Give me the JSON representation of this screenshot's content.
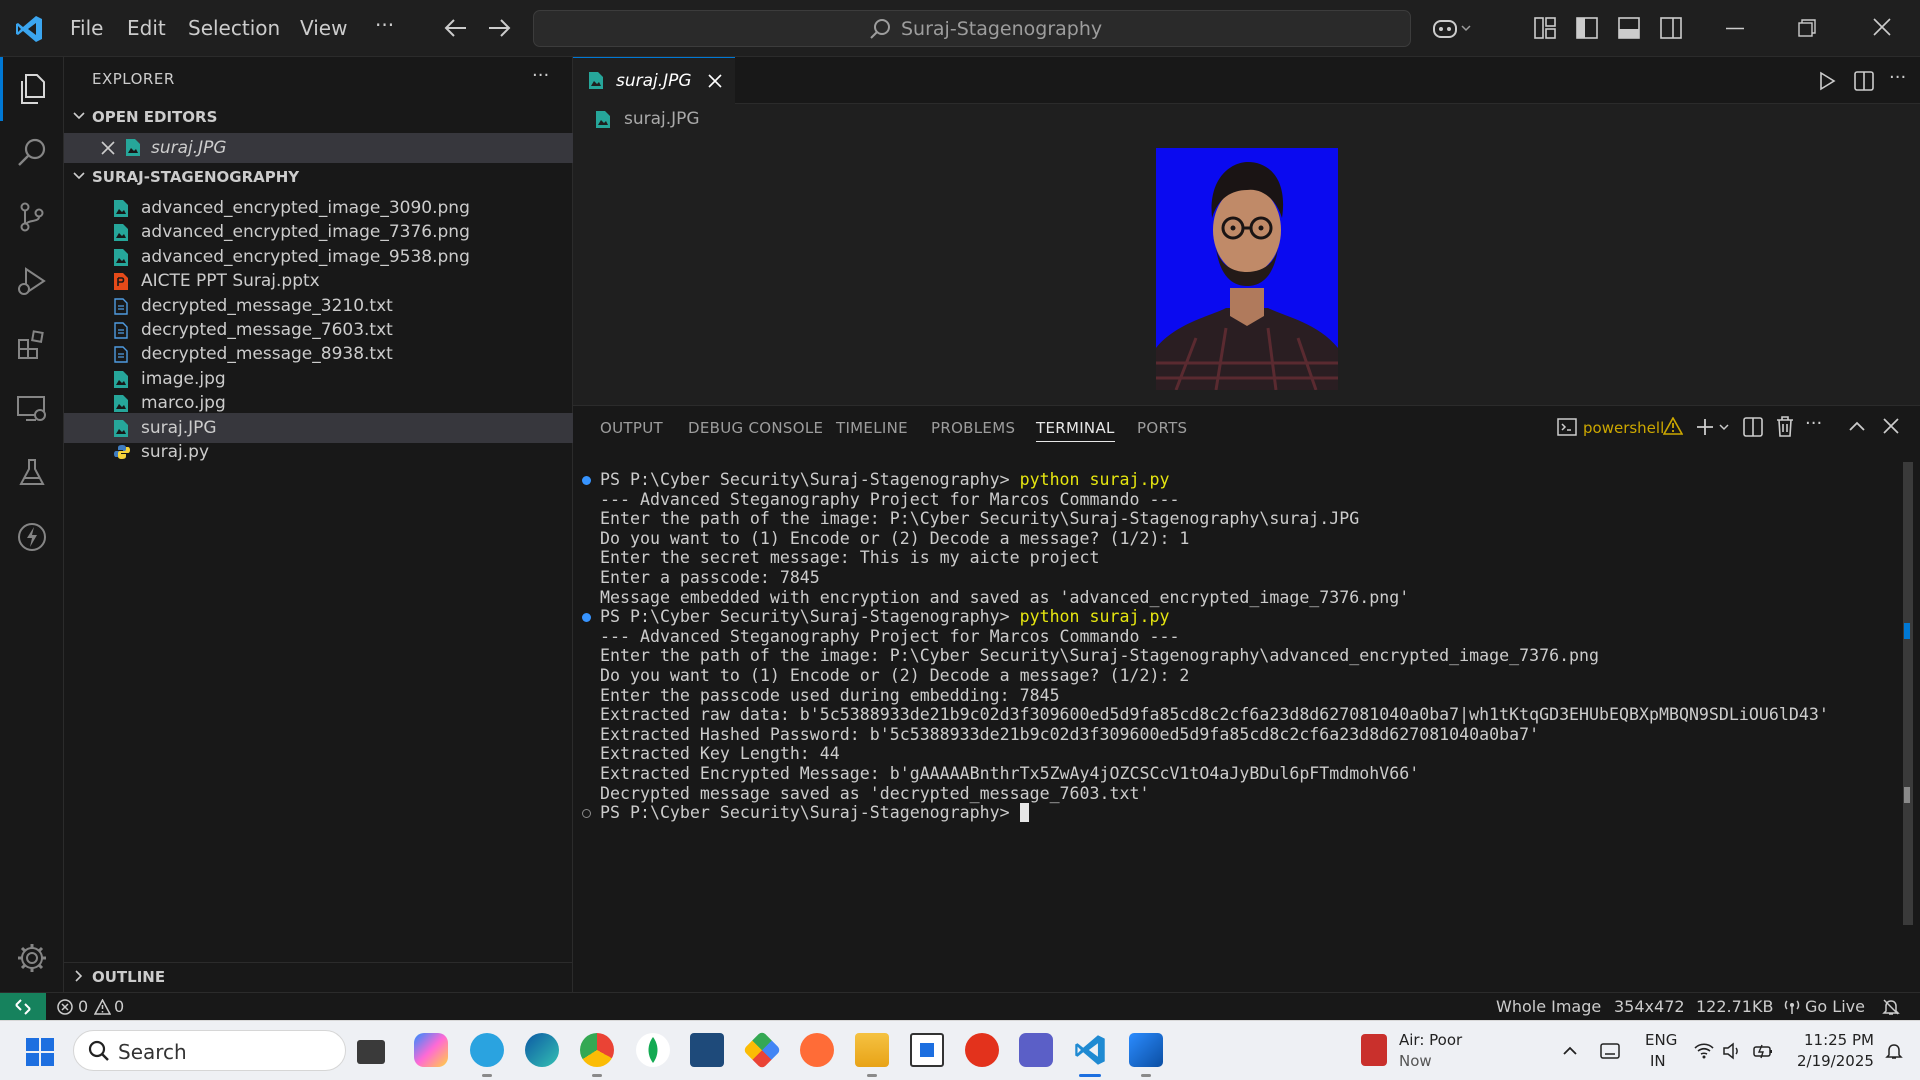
{
  "titlebar": {
    "menus": [
      "File",
      "Edit",
      "Selection",
      "View"
    ],
    "more": "···",
    "search_text": "Suraj-Stagenography"
  },
  "sidebar": {
    "header": "EXPLORER",
    "more": "···",
    "open_editors_label": "OPEN EDITORS",
    "open_editor_file": "suraj.JPG",
    "project_label": "SURAJ-STAGENOGRAPHY",
    "files": [
      {
        "name": "advanced_encrypted_image_3090.png",
        "type": "image"
      },
      {
        "name": "advanced_encrypted_image_7376.png",
        "type": "image"
      },
      {
        "name": "advanced_encrypted_image_9538.png",
        "type": "image"
      },
      {
        "name": "AICTE PPT Suraj.pptx",
        "type": "pptx"
      },
      {
        "name": "decrypted_message_3210.txt",
        "type": "text"
      },
      {
        "name": "decrypted_message_7603.txt",
        "type": "text"
      },
      {
        "name": "decrypted_message_8938.txt",
        "type": "text"
      },
      {
        "name": "image.jpg",
        "type": "image"
      },
      {
        "name": "marco.jpg",
        "type": "image"
      },
      {
        "name": "suraj.JPG",
        "type": "image"
      },
      {
        "name": "suraj.py",
        "type": "python"
      }
    ],
    "outline_label": "OUTLINE"
  },
  "editor": {
    "tab_name": "suraj.JPG",
    "breadcrumb": "suraj.JPG"
  },
  "panel": {
    "tabs": [
      "OUTPUT",
      "DEBUG CONSOLE",
      "TIMELINE",
      "PROBLEMS",
      "TERMINAL",
      "PORTS"
    ],
    "active_tab": "TERMINAL",
    "shell": "powershell",
    "terminal_lines": [
      {
        "prompt": "PS P:\\Cyber Security\\Suraj-Stagenography> ",
        "cmd": "python suraj.py",
        "dot": "blue"
      },
      {
        "text": "--- Advanced Steganography Project for Marcos Commando ---"
      },
      {
        "text": "Enter the path of the image: P:\\Cyber Security\\Suraj-Stagenography\\suraj.JPG"
      },
      {
        "text": "Do you want to (1) Encode or (2) Decode a message? (1/2): 1"
      },
      {
        "text": "Enter the secret message: This is my aicte project"
      },
      {
        "text": "Enter a passcode: 7845"
      },
      {
        "text": "Message embedded with encryption and saved as 'advanced_encrypted_image_7376.png'"
      },
      {
        "prompt": "PS P:\\Cyber Security\\Suraj-Stagenography> ",
        "cmd": "python suraj.py",
        "dot": "blue"
      },
      {
        "text": "--- Advanced Steganography Project for Marcos Commando ---"
      },
      {
        "text": "Enter the path of the image: P:\\Cyber Security\\Suraj-Stagenography\\advanced_encrypted_image_7376.png"
      },
      {
        "text": "Do you want to (1) Encode or (2) Decode a message? (1/2): 2"
      },
      {
        "text": "Enter the passcode used during embedding: 7845"
      },
      {
        "text": "Extracted raw data: b'5c5388933de21b9c02d3f309600ed5d9fa85cd8c2cf6a23d8d627081040a0ba7|wh1tKtqGD3EHUbEQBXpMBQN9SDLiOU6lD43'"
      },
      {
        "text": "Extracted Hashed Password: b'5c5388933de21b9c02d3f309600ed5d9fa85cd8c2cf6a23d8d627081040a0ba7'"
      },
      {
        "text": "Extracted Key Length: 44"
      },
      {
        "text": "Extracted Encrypted Message: b'gAAAAABnthrTx5ZwAy4jOZCSCcV1tO4aJyBDul6pFTmdmohV66'"
      },
      {
        "text": "Decrypted message saved as 'decrypted_message_7603.txt'"
      },
      {
        "prompt": "PS P:\\Cyber Security\\Suraj-Stagenography> ",
        "cmd": "",
        "dot": "empty",
        "cursor": true
      }
    ]
  },
  "statusbar": {
    "errors": "0",
    "warnings": "0",
    "zoom_mode": "Whole Image",
    "dimensions": "354x472",
    "filesize": "122.71KB",
    "go_live": "Go Live"
  },
  "taskbar": {
    "search": "Search",
    "weather_title": "Air: Poor",
    "weather_sub": "Now",
    "lang_top": "ENG",
    "lang_bottom": "IN",
    "time": "11:25 PM",
    "date": "2/19/2025"
  },
  "colors": {
    "accent": "#0078d4",
    "remote": "#16825d",
    "prompt_cmd": "#e5e510",
    "warning": "#cca700",
    "photo_bg": "#0a0af0"
  }
}
